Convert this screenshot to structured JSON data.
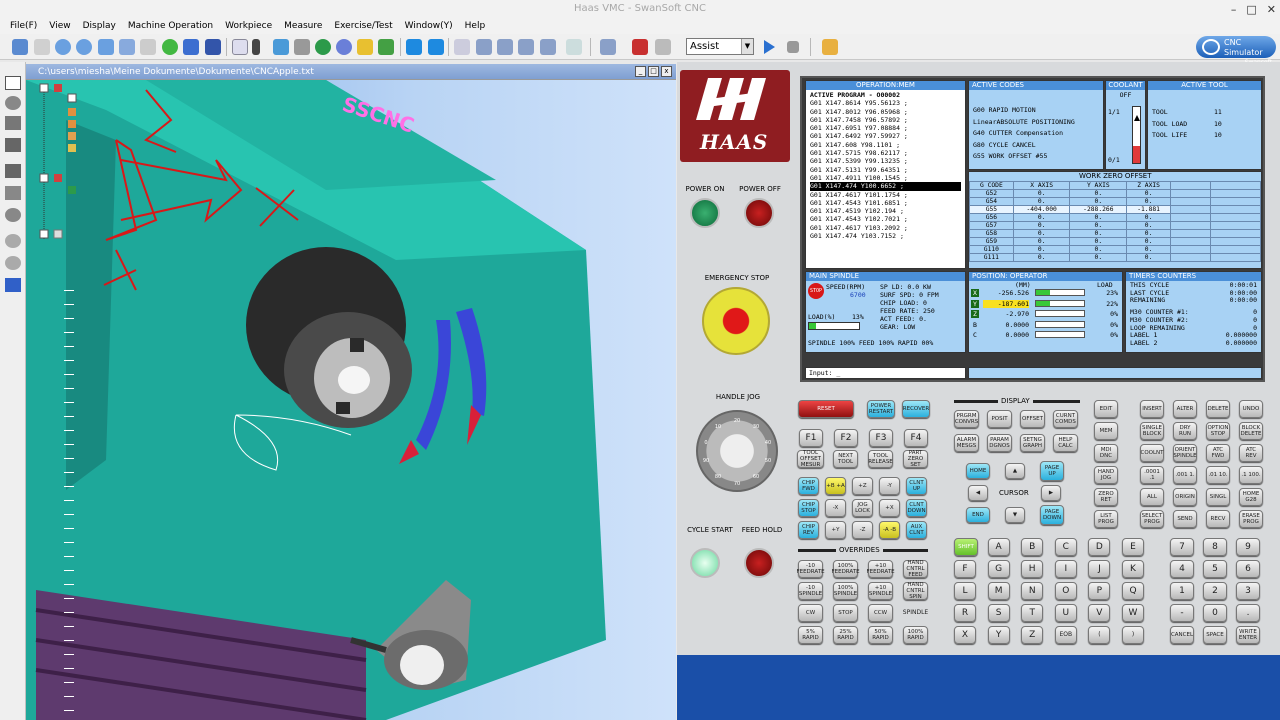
{
  "window": {
    "title": "Haas VMC - SwanSoft CNC"
  },
  "menu": [
    "File(F)",
    "View",
    "Display",
    "Machine Operation",
    "Workpiece",
    "Measure",
    "Exercise/Test",
    "Window(Y)",
    "Help"
  ],
  "toolbar": {
    "mode": "Assist"
  },
  "brand": {
    "line1": "CNC Simulator",
    "line2": "Swansoft"
  },
  "viewport": {
    "path": "C:\\users\\miesha\\Meine Dokumente\\Dokumente\\CNCApple.txt",
    "engraving": "SSCNC"
  },
  "controller": {
    "logo_text": "HAAS",
    "power_on": "POWER ON",
    "power_off": "POWER OFF",
    "emergency_stop": "EMERGENCY STOP",
    "handle_jog": "HANDLE JOG",
    "jog_ticks": [
      "20",
      "30",
      "40",
      "50",
      "60",
      "70",
      "80",
      "90",
      "0",
      "10"
    ],
    "cycle_start": "CYCLE START",
    "feed_hold": "FEED HOLD"
  },
  "screen": {
    "program_title": "OPERATION:MEM",
    "program_header": "ACTIVE PROGRAM - O00002",
    "program_lines": [
      "G01 X147.8614 Y95.56123 ;",
      "G01 X147.8012 Y96.05968 ;",
      "G01 X147.7458 Y96.57892 ;",
      "G01 X147.6951 Y97.08884 ;",
      "G01 X147.6492 Y97.59927 ;",
      "G01 X147.608 Y98.1101 ;",
      "G01 X147.5715 Y98.62117 ;",
      "G01 X147.5399 Y99.13235 ;",
      "G01 X147.5131 Y99.64351 ;",
      "G01 X147.4911 Y100.1545 ;",
      "G01 X147.474 Y100.6652 ;",
      "G01 X147.4617 Y101.1754 ;",
      "G01 X147.4543 Y101.6851 ;",
      "G01 X147.4519 Y102.194 ;",
      "G01 X147.4543 Y102.7021 ;",
      "G01 X147.4617 Y103.2092 ;",
      "G01 X147.474 Y103.7152 ;"
    ],
    "active_line_index": 10,
    "active_codes_title": "ACTIVE CODES",
    "active_codes": [
      "G00  RAPID MOTION",
      "LinearABSOLUTE POSITIONING",
      "G40  CUTTER Compensation",
      "G80  CYCLE CANCEL",
      "G55  WORK OFFSET #55"
    ],
    "coolant_title": "COOLANT",
    "coolant_state": "OFF",
    "coolant_top": "1/1",
    "coolant_bottom": "0/1",
    "coolant_level": 0.3,
    "active_tool_title": "ACTIVE TOOL",
    "active_tool": [
      {
        "label": "TOOL",
        "value": "11"
      },
      {
        "label": "TOOL LOAD",
        "value": "10"
      },
      {
        "label": "TOOL LIFE",
        "value": "10"
      }
    ],
    "work_offset_title": "WORK ZERO OFFSET",
    "work_offset_headers": [
      "G CODE",
      "X AXIS",
      "Y AXIS",
      "Z AXIS"
    ],
    "work_offsets": [
      [
        "G52",
        "0.",
        "0.",
        "0."
      ],
      [
        "G54",
        "0.",
        "0.",
        "0."
      ],
      [
        "G55",
        "-404.000",
        "-288.266",
        "-1.881"
      ],
      [
        "G56",
        "0.",
        "0.",
        "0."
      ],
      [
        "G57",
        "0.",
        "0.",
        "0."
      ],
      [
        "G58",
        "0.",
        "0.",
        "0."
      ],
      [
        "G59",
        "0.",
        "0.",
        "0."
      ],
      [
        "G110",
        "0.",
        "0.",
        "0."
      ],
      [
        "G111",
        "0.",
        "0.",
        "0."
      ]
    ],
    "spindle_title": "MAIN SPINDLE",
    "spindle": {
      "stop": "STOP",
      "speed_label": "SPEED(RPM)",
      "speed": "6700",
      "load_label": "LOAD(%)",
      "load": "13%",
      "load_level": 0.13,
      "right": [
        "SP LD:   0.0   KW",
        "SURF SPD:  0    FPM",
        "CHIP LOAD:  0",
        "FEED RATE: 250",
        "ACT FEED:  0.",
        "GEAR: LOW"
      ],
      "footer": "SPINDLE 100%  FEED 100%  RAPID  00%"
    },
    "position_title": "POSITION: OPERATOR",
    "position_unit": "(MM)",
    "position_load": "LOAD",
    "positions": [
      {
        "axis": "X",
        "value": "-256.526",
        "load": "23%",
        "level": 0.23
      },
      {
        "axis": "Y",
        "value": "-187.601",
        "load": "22%",
        "level": 0.22
      },
      {
        "axis": "Z",
        "value": "-2.970",
        "load": "0%",
        "level": 0.0
      },
      {
        "axis": "B",
        "value": "0.0000",
        "load": "0%",
        "level": 0.0
      },
      {
        "axis": "C",
        "value": "0.0000",
        "load": "0%",
        "level": 0.0
      }
    ],
    "timers_title": "TIMERS   COUNTERS",
    "timers": [
      [
        "THIS CYCLE",
        "0:00:01"
      ],
      [
        "LAST CYCLE",
        "0:00:00"
      ],
      [
        "REMAINING",
        "0:00:00"
      ],
      [
        "M30 COUNTER #1:",
        "0"
      ],
      [
        "M30 COUNTER #2:",
        "0"
      ],
      [
        "LOOP REMAINING",
        "0"
      ],
      [
        "LABEL 1",
        "0.000000"
      ],
      [
        "LABEL 2",
        "0.000000"
      ]
    ],
    "input_label": "Input: _"
  },
  "keys": {
    "reset": "RESET",
    "power_restart": "POWER RESTART",
    "recover": "RECOVER",
    "f": [
      "F1",
      "F2",
      "F3",
      "F4"
    ],
    "tool_row": [
      "TOOL OFFSET MESUR",
      "NEXT TOOL",
      "TOOL RELEASE",
      "PART ZERO SET"
    ],
    "jog_keys": [
      "CHIP FWD",
      "+B +A",
      "+Z",
      "-Y",
      "CLNT UP",
      "CHIP STOP",
      "-X",
      "JOG LOCK",
      "+X",
      "CLNT DOWN",
      "CHIP REV",
      "+Y",
      "-Z",
      "-A -B",
      "AUX CLNT"
    ],
    "overrides_title": "OVERRIDES",
    "overrides": [
      "-10 FEEDRATE",
      "100% FEEDRATE",
      "+10 FEEDRATE",
      "HAND CNTRL FEED",
      "-10 SPINDLE",
      "100% SPINDLE",
      "+10 SPINDLE",
      "HAND CNTRL SPIN",
      "CW",
      "STOP",
      "CCW",
      "SPINDLE",
      "5% RAPID",
      "25% RAPID",
      "50% RAPID",
      "100% RAPID"
    ],
    "display_title": "DISPLAY",
    "display": [
      "PRGRM CONVRS",
      "POSIT",
      "OFFSET",
      "CURNT COMDS",
      "ALARM MESGS",
      "PARAM DGNOS",
      "SETNG GRAPH",
      "HELP CALC"
    ],
    "cursor_title": "CURSOR",
    "cursor": [
      "HOME",
      "PAGE UP",
      "PAGE DOWN",
      "END"
    ],
    "edit": [
      "EDIT",
      "INSERT",
      "ALTER",
      "DELETE",
      "UNDO",
      "MEM",
      "SINGLE BLOCK",
      "DRY RUN",
      "OPTION STOP",
      "BLOCK DELETE",
      "MDI DNC",
      "COOLNT",
      "ORIENT SPINDLE",
      "ATC FWD",
      "ATC REV",
      "HAND JOG",
      ".0001 .1",
      ".001 1.",
      ".01 10.",
      ".1 100.",
      "ZERO RET",
      "ALL",
      "ORIGIN",
      "SINGL",
      "HOME G28",
      "LIST PROG",
      "SELECT PROG",
      "SEND",
      "RECV",
      "ERASE PROG"
    ],
    "shift": "SHIFT",
    "letters": [
      "A",
      "B",
      "C",
      "D",
      "E",
      "F",
      "G",
      "H",
      "I",
      "J",
      "K",
      "L",
      "M",
      "N",
      "O",
      "P",
      "Q",
      "R",
      "S",
      "T",
      "U",
      "V",
      "W",
      "X",
      "Y",
      "Z",
      "EOB",
      "(",
      ")"
    ],
    "nums": [
      "7",
      "8",
      "9",
      "4",
      "5",
      "6",
      "1",
      "2",
      "3",
      "-",
      "0",
      "."
    ],
    "bottom": [
      "CANCEL",
      "SPACE",
      "WRITE ENTER"
    ]
  }
}
